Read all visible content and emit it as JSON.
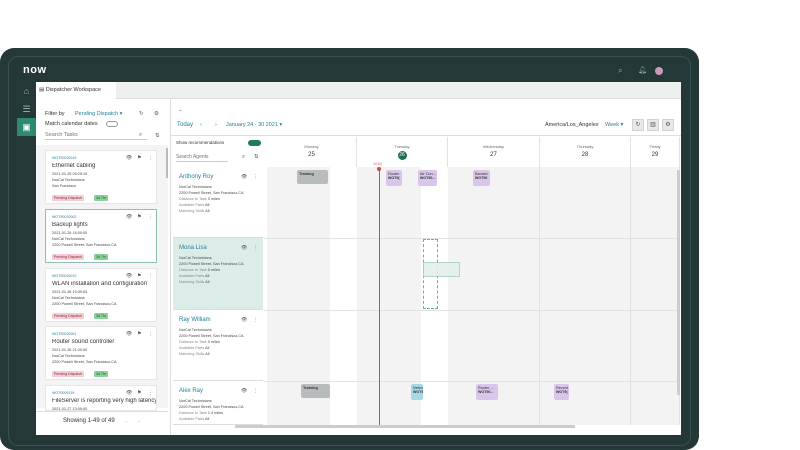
{
  "app": {
    "logo": "now",
    "tab_title": "Dispatcher Workspace"
  },
  "tasks_panel": {
    "filter_label": "Filter by",
    "filter_value": "Pending Dispatch",
    "match_label": "Match calendar dates",
    "search_placeholder": "Search Tasks",
    "showing": "Showing 1-49 of 49",
    "cards": [
      {
        "id": "WOT90010019",
        "title": "Ethernet cabling",
        "date": "2021-01-25 09:25:15",
        "group": "NorCal Technicians",
        "addr": "San Francisco",
        "status": "Pending Dispatch",
        "sla": "3d 7hr"
      },
      {
        "id": "WOT90010002",
        "title": "Backup lights",
        "date": "2021-01-26 16:00:00",
        "group": "NorCal Technicians",
        "addr": "2200 Powell Street, San Francisco,CA",
        "status": "Pending Dispatch",
        "sla": "3d 7hr"
      },
      {
        "id": "WOT90010010",
        "title": "WLAN installation and configuration",
        "date": "2021-01-26 19:39:53",
        "group": "NorCal Technicians",
        "addr": "2200 Powell Street, San Francisco,CA",
        "status": "Pending Dispatch",
        "sla": "3d 7hr"
      },
      {
        "id": "WOT90010001",
        "title": "Router sound controller",
        "date": "2021-01-26 21:00:00",
        "group": "NorCal Technicians",
        "addr": "2200 Powell Street, San Francisco,CA",
        "status": "Pending Dispatch",
        "sla": "3d 7hr"
      },
      {
        "id": "WOT0009139",
        "title": "FileServer is reporting very high latency",
        "date": "2021-01-27 13:00:00",
        "group": "",
        "addr": "",
        "status": "",
        "sla": ""
      }
    ]
  },
  "calendar": {
    "today": "Today",
    "range": "January 24 - 30 2021",
    "timezone": "America/Los_Angeles",
    "view": "Week",
    "show_recs": "Show recommendations",
    "search_agents": "Search Agents",
    "now_time": "10:04",
    "days": [
      {
        "name": "Monday",
        "num": "25"
      },
      {
        "name": "Tuesday",
        "num": "26"
      },
      {
        "name": "Wednesday",
        "num": "27"
      },
      {
        "name": "Thursday",
        "num": "28"
      },
      {
        "name": "Friday",
        "num": "29"
      }
    ],
    "labels": {
      "distance": "Distance to Task",
      "parts": "Available Parts",
      "skills": "Matching Skills"
    },
    "agents": [
      {
        "name": "Anthony Roy",
        "group": "NorCal Technicians",
        "addr": "2200 Powell Street, San Francisco,CA",
        "distance": "0 miles",
        "parts": "All",
        "skills": "All"
      },
      {
        "name": "Mona Lisa",
        "group": "NorCal Technicians",
        "addr": "2200 Powell Street, San Francisco,CA",
        "distance": "0 miles",
        "parts": "All",
        "skills": "All"
      },
      {
        "name": "Ray William",
        "group": "NorCal Technicians",
        "addr": "2200 Powell Street, San Francisco,CA",
        "distance": "0 miles",
        "parts": "All",
        "skills": "All"
      },
      {
        "name": "Alex Ray",
        "group": "NorCal Technicians",
        "addr": "2200 Powell Street, San Francisco,CA",
        "distance": "1.4 miles",
        "parts": "All",
        "skills": ""
      }
    ],
    "events": [
      {
        "title": "Training",
        "id": ""
      },
      {
        "title": "Router",
        "id": "WOT9("
      },
      {
        "title": "Air Con...",
        "id": "WOT90..."
      },
      {
        "title": "Bandwi",
        "id": "WOT90"
      },
      {
        "title": "Training",
        "id": ""
      },
      {
        "title": "Netwo",
        "id": "WOT9"
      },
      {
        "title": "Router ...",
        "id": "WOT90..."
      },
      {
        "title": "Reconf",
        "id": "WOT9("
      }
    ]
  }
}
